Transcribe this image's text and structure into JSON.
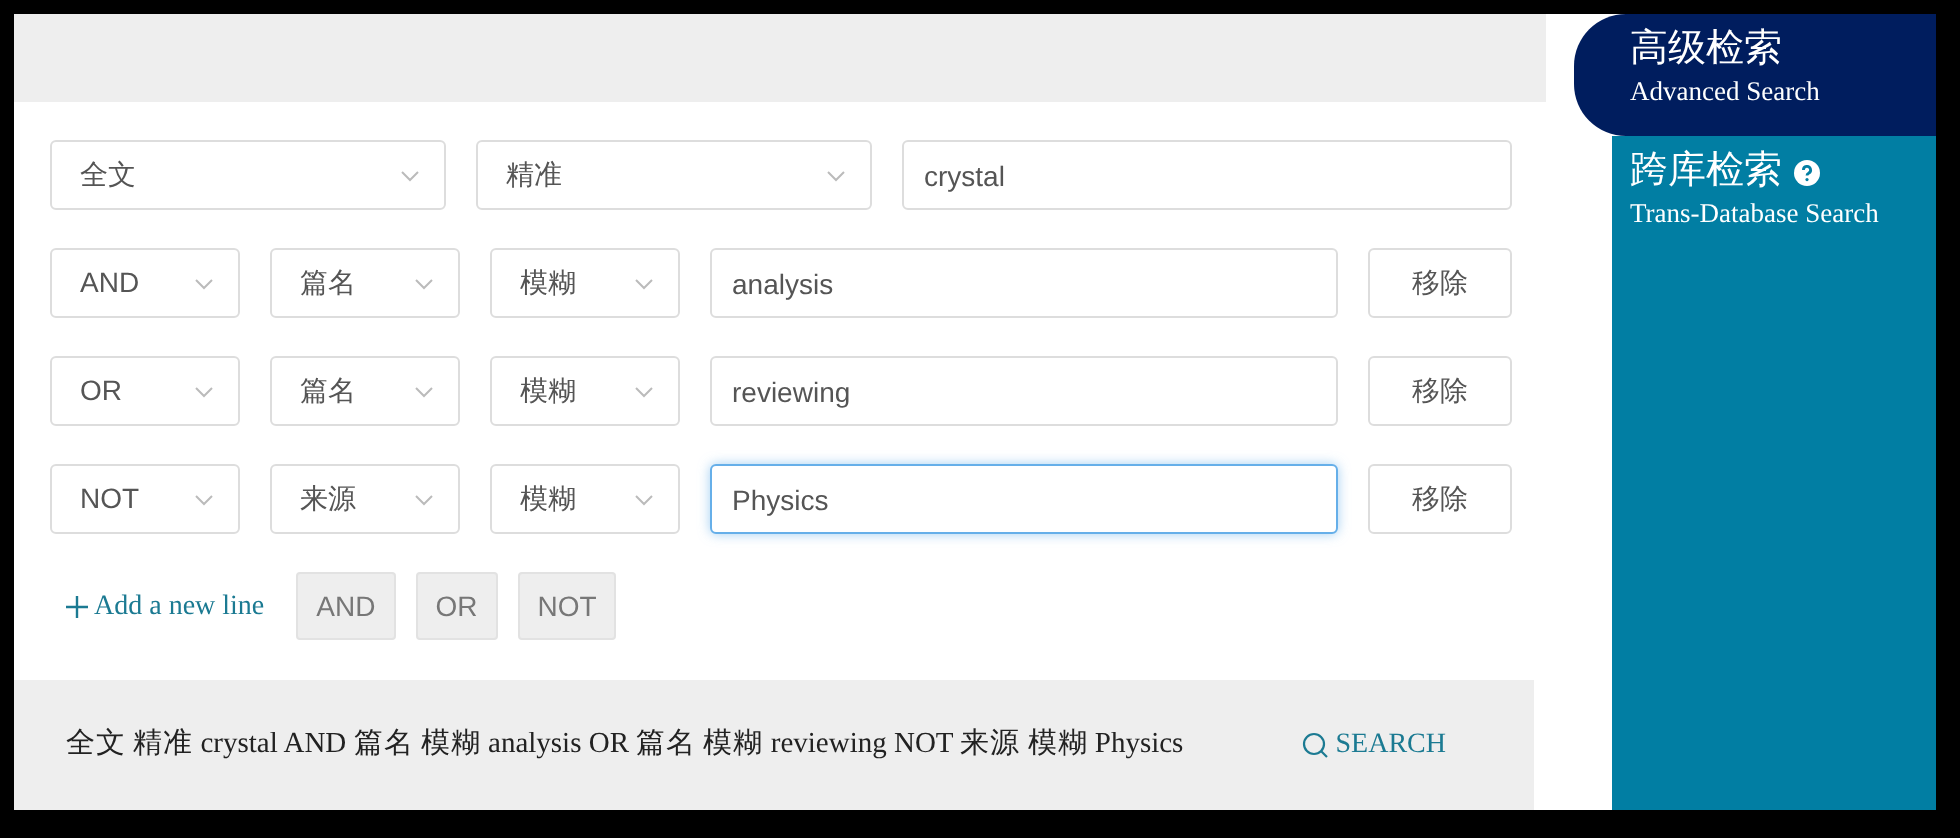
{
  "first_row": {
    "field": "全文",
    "match": "精准",
    "value": "crystal",
    "focused": false
  },
  "rows": [
    {
      "operator": "AND",
      "field": "篇名",
      "match": "模糊",
      "value": "analysis",
      "focused": false,
      "remove": "移除"
    },
    {
      "operator": "OR",
      "field": "篇名",
      "match": "模糊",
      "value": "reviewing",
      "focused": false,
      "remove": "移除"
    },
    {
      "operator": "NOT",
      "field": "来源",
      "match": "模糊",
      "value": "Physics",
      "focused": true,
      "remove": "移除"
    }
  ],
  "add_line": {
    "label": "Add a new line"
  },
  "operator_buttons": [
    "AND",
    "OR",
    "NOT"
  ],
  "summary": {
    "text": "全文 精准 crystal AND 篇名 模糊 analysis OR 篇名 模糊 reviewing NOT 来源 模糊 Physics",
    "search_button": "SEARCH"
  },
  "sidebar": {
    "items": [
      {
        "title": "高级检索",
        "subtitle": "Advanced Search",
        "selected": true,
        "help_icon": false
      },
      {
        "title": "跨库检索",
        "subtitle": "Trans-Database Search",
        "selected": false,
        "help_icon": true
      }
    ]
  }
}
